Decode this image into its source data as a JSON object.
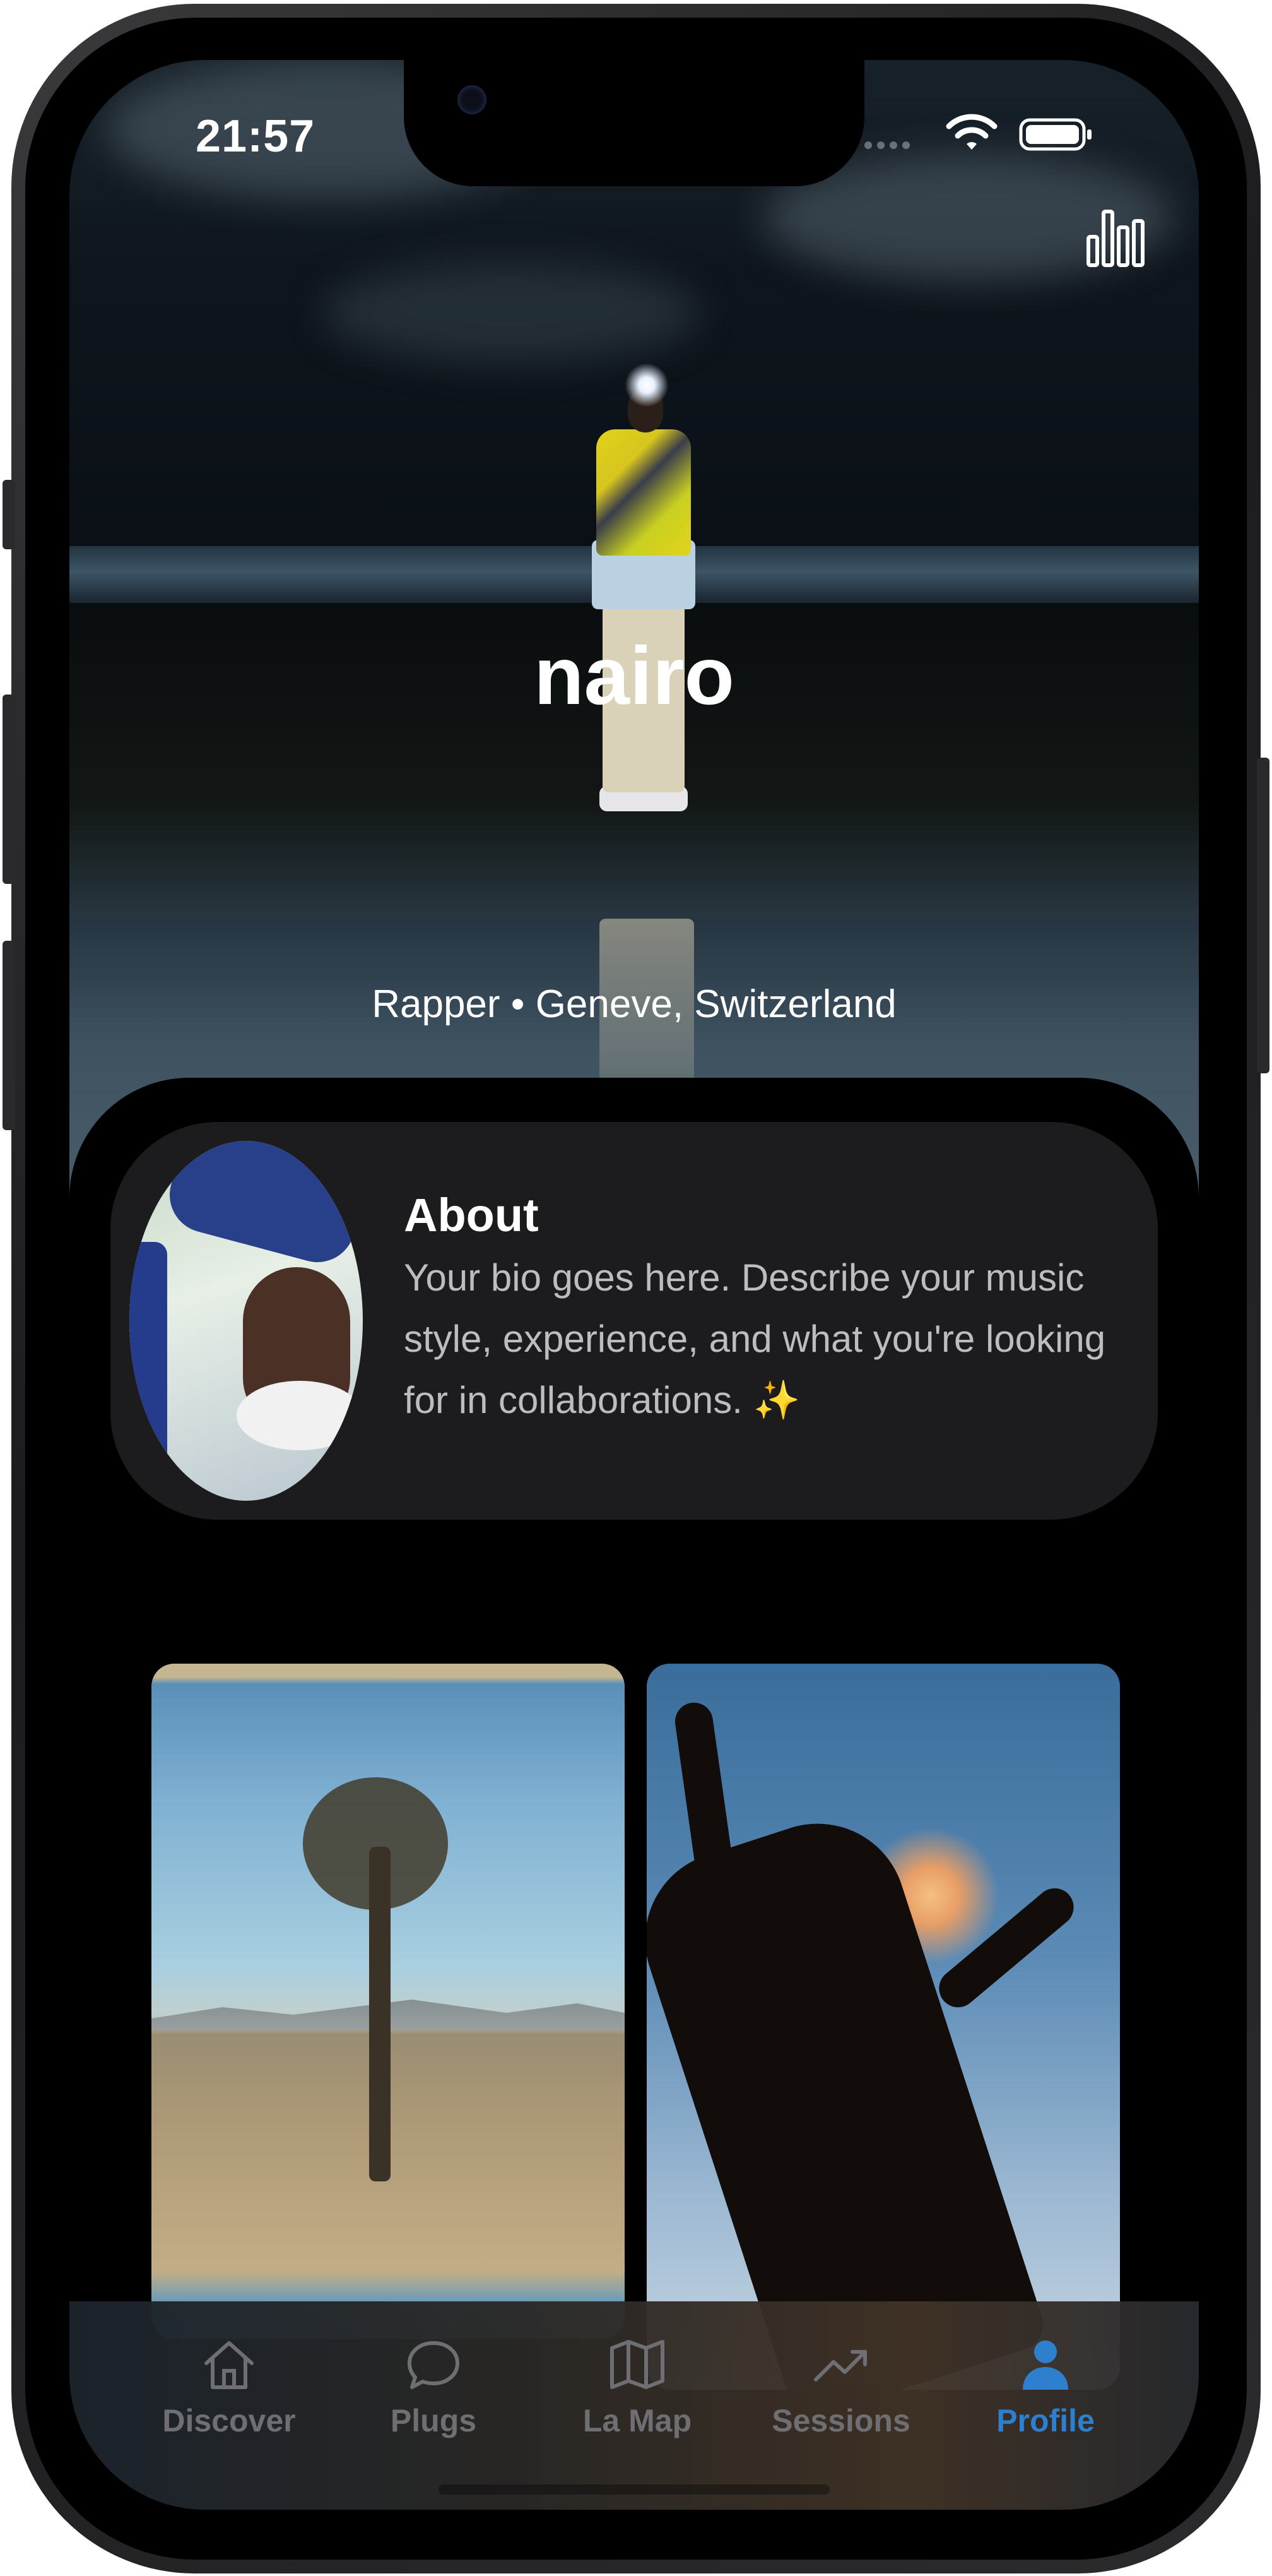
{
  "status_bar": {
    "time": "21:57"
  },
  "hero": {
    "name": "nairo",
    "subtitle": "Rapper • Geneve, Switzerland"
  },
  "about": {
    "title": "About",
    "body": "Your bio goes here. Describe your music style, experience, and what you're looking for in collaborations. ✨"
  },
  "tabs": [
    {
      "label": "Discover",
      "icon": "home-icon",
      "active": false
    },
    {
      "label": "Plugs",
      "icon": "chat-bubble-icon",
      "active": false
    },
    {
      "label": "La Map",
      "icon": "map-icon",
      "active": false
    },
    {
      "label": "Sessions",
      "icon": "trending-up-icon",
      "active": false
    },
    {
      "label": "Profile",
      "icon": "person-icon",
      "active": true
    }
  ],
  "colors": {
    "accent": "#2f7fcf",
    "tab_inactive": "#6e6e73",
    "card_bg": "#1c1c1e"
  }
}
